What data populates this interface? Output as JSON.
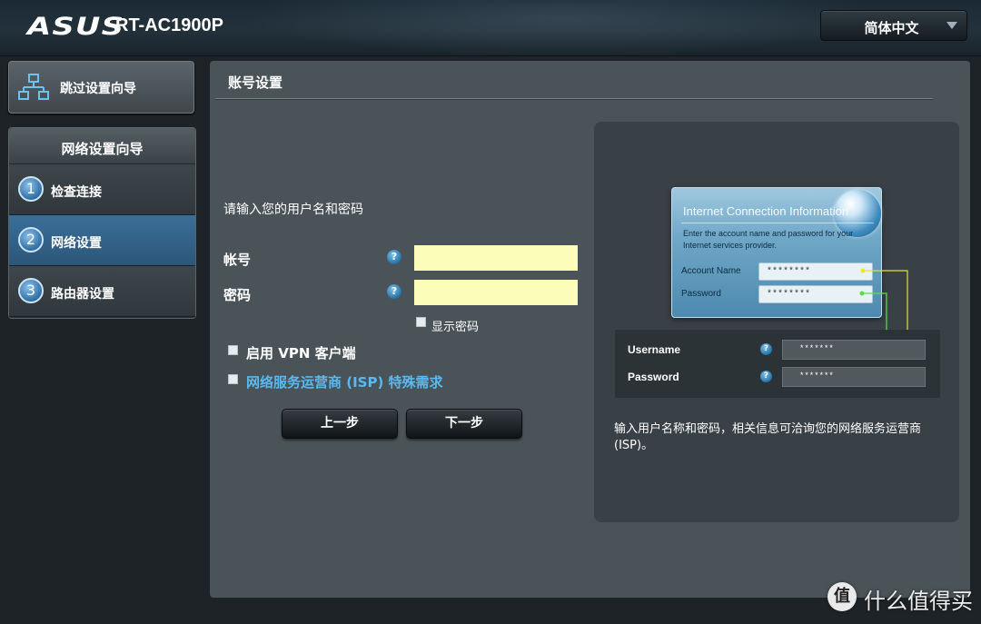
{
  "header": {
    "brand": "ASUS",
    "model": "RT-AC1900P",
    "language": "简体中文"
  },
  "sidebar": {
    "skip_label": "跳过设置向导",
    "wizard_title": "网络设置向导",
    "steps": [
      {
        "num": "1",
        "label": "检查连接"
      },
      {
        "num": "2",
        "label": "网络设置"
      },
      {
        "num": "3",
        "label": "路由器设置"
      }
    ],
    "active_step": 2
  },
  "main": {
    "title": "账号设置",
    "prompt": "请输入您的用户名和密码",
    "account_label": "帐号",
    "password_label": "密码",
    "account_value": "",
    "password_value": "",
    "show_password_label": "显示密码",
    "vpn_label": "启用 VPN 客户端",
    "isp_label": "网络服务运营商 (ISP) 特殊需求",
    "prev_button": "上一步",
    "next_button": "下一步",
    "help_glyph": "?"
  },
  "illustration": {
    "card_title": "Internet Connection Information",
    "card_desc": "Enter the account name and password for your Internet services provider.",
    "account_name_label": "Account Name",
    "password_label": "Password",
    "account_mask": "********",
    "password_mask": "********",
    "form_username_label": "Username",
    "form_password_label": "Password",
    "form_username_mask": "*******",
    "form_password_mask": "*******",
    "note": "输入用户名称和密码，相关信息可洽询您的网络服务运营商 (ISP)。"
  },
  "watermark": {
    "glyph": "值",
    "text": "什么值得买"
  },
  "colors": {
    "input_bg": "#fdfdba",
    "link": "#59b9f2",
    "active_step": "#2c5679",
    "panel": "#4a5358"
  }
}
